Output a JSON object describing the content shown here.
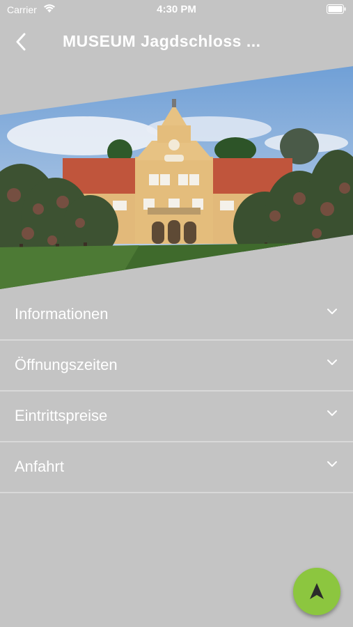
{
  "status_bar": {
    "carrier": "Carrier",
    "time": "4:30 PM"
  },
  "nav": {
    "title": "MUSEUM Jagdschloss ...",
    "back_icon": "chevron-left-icon"
  },
  "hero": {
    "image": "photo of Jagdschloss castle building with trees and lawn"
  },
  "accordion": {
    "items": [
      {
        "label": "Informationen"
      },
      {
        "label": "Öffnungszeiten"
      },
      {
        "label": "Eintrittspreise"
      },
      {
        "label": "Anfahrt"
      }
    ]
  },
  "fab": {
    "icon": "navigation-arrow-icon"
  },
  "colors": {
    "background": "#c4c4c4",
    "fab": "#8cc63f",
    "text": "#ffffff",
    "divider": "#d9d9d9"
  }
}
